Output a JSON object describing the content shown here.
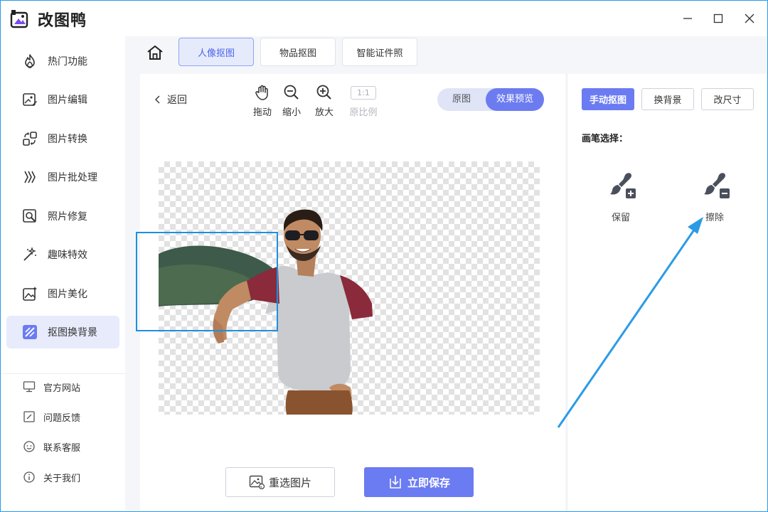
{
  "app": {
    "title": "改图鸭"
  },
  "sidebar": {
    "items": [
      {
        "label": "热门功能",
        "icon": "flame-icon"
      },
      {
        "label": "图片编辑",
        "icon": "image-edit-icon"
      },
      {
        "label": "图片转换",
        "icon": "convert-icon"
      },
      {
        "label": "图片批处理",
        "icon": "batch-icon"
      },
      {
        "label": "照片修复",
        "icon": "photo-repair-icon"
      },
      {
        "label": "趣味特效",
        "icon": "magic-wand-icon"
      },
      {
        "label": "图片美化",
        "icon": "beautify-icon"
      },
      {
        "label": "抠图换背景",
        "icon": "cutout-icon",
        "active": true
      }
    ],
    "links": [
      {
        "label": "官方网站",
        "icon": "monitor-icon"
      },
      {
        "label": "问题反馈",
        "icon": "feedback-icon"
      },
      {
        "label": "联系客服",
        "icon": "support-icon"
      },
      {
        "label": "关于我们",
        "icon": "info-icon"
      }
    ]
  },
  "tabs": [
    "人像抠图",
    "物品抠图",
    "智能证件照"
  ],
  "toolbar": {
    "back": "返回",
    "drag": "拖动",
    "zoom_out": "缩小",
    "zoom_in": "放大",
    "ratio_box": "1:1",
    "ratio_label": "原比例",
    "toggle_original": "原图",
    "toggle_preview": "效果预览"
  },
  "actions": {
    "reselect": "重选图片",
    "save": "立即保存"
  },
  "right_panel": {
    "buttons": [
      "手动抠图",
      "换背景",
      "改尺寸"
    ],
    "brush_title": "画笔选择：",
    "keep": "保留",
    "erase": "擦除"
  },
  "colors": {
    "accent": "#6b7bf2",
    "selection": "#1e8fe0",
    "active_bg": "#e7ebfb"
  }
}
